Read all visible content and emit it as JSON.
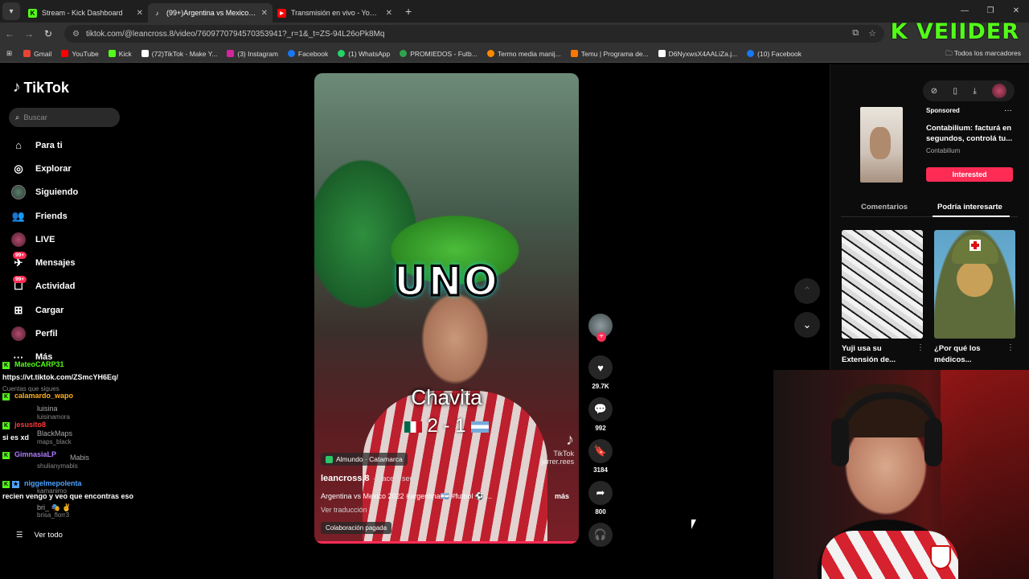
{
  "browser": {
    "tabs": [
      {
        "title": "Stream - Kick Dashboard",
        "favicon": "kick-icon",
        "color": "#53fc18",
        "active": false
      },
      {
        "title": "(99+)Argentina vs Mexico 2022",
        "favicon": "tiktok-icon",
        "color": "#ffffff",
        "active": true
      },
      {
        "title": "Transmisión en vivo - YouTube",
        "favicon": "youtube-icon",
        "color": "#ff0000",
        "active": false
      }
    ],
    "url": "tiktok.com/@leancross.8/video/7609770794570353941?_r=1&_t=ZS-94L26oPk8Mq",
    "bookmarks": [
      {
        "label": "Gmail",
        "color": "#ea4335"
      },
      {
        "label": "YouTube",
        "color": "#ff0000"
      },
      {
        "label": "Kick",
        "color": "#53fc18"
      },
      {
        "label": "(72)TikTok - Make Y...",
        "color": "#ffffff"
      },
      {
        "label": "(3) Instagram",
        "color": "#d6249f"
      },
      {
        "label": "Facebook",
        "color": "#1877f2"
      },
      {
        "label": "(1) WhatsApp",
        "color": "#25d366"
      },
      {
        "label": "PROMIEDOS - Futb...",
        "color": "#2ea44f"
      },
      {
        "label": "Termo media manij...",
        "color": "#ff8a00"
      },
      {
        "label": "Temu | Programa de...",
        "color": "#fb7701"
      },
      {
        "label": "D6NyxwsX4AALiZa.j...",
        "color": "#ffffff"
      },
      {
        "label": "(10) Facebook",
        "color": "#1877f2"
      }
    ],
    "all_bookmarks": "Todos los marcadores",
    "overlay_logo": "K VEIIDER"
  },
  "sidebar": {
    "brand": "TikTok",
    "search_placeholder": "Buscar",
    "items": [
      {
        "label": "Para ti",
        "icon": "home-icon"
      },
      {
        "label": "Explorar",
        "icon": "compass-icon"
      },
      {
        "label": "Siguiendo",
        "icon": "following-avatar-icon"
      },
      {
        "label": "Friends",
        "icon": "friends-icon"
      },
      {
        "label": "LIVE",
        "icon": "live-icon"
      },
      {
        "label": "Mensajes",
        "icon": "messages-icon",
        "badge": "99+"
      },
      {
        "label": "Actividad",
        "icon": "activity-icon",
        "badge": "99+"
      },
      {
        "label": "Cargar",
        "icon": "upload-icon"
      },
      {
        "label": "Perfil",
        "icon": "profile-icon"
      },
      {
        "label": "Más",
        "icon": "more-icon"
      }
    ],
    "see_all": "Ver todo"
  },
  "chat": {
    "lines": [
      {
        "user": "MateoCARP31",
        "color": "#53fc18",
        "text": ""
      },
      {
        "user": "",
        "color": "#ffffff",
        "text": "https://vt.tiktok.com/ZSmcYH6Eq/"
      },
      {
        "user": "",
        "color": "#888888",
        "text": "Cuentas que sigues"
      },
      {
        "user": "calamardo_wapo",
        "color": "#ffb020",
        "text": ""
      },
      {
        "user": "",
        "color": "#aaaaaa",
        "text": "luisina"
      },
      {
        "user": "",
        "color": "#777777",
        "text": "luisinamora"
      },
      {
        "user": "jesusito8",
        "color": "#ff3a3a",
        "text": ""
      },
      {
        "user": "",
        "color": "#ffffff",
        "text": "si es xd"
      },
      {
        "user": "",
        "color": "#aaaaaa",
        "text": "BlackMaps"
      },
      {
        "user": "",
        "color": "#777777",
        "text": "maps_black"
      },
      {
        "user": "GimnasiaLP",
        "color": "#b07cff",
        "text": ""
      },
      {
        "user": "",
        "color": "#aaaaaa",
        "text": "Mabis"
      },
      {
        "user": "",
        "color": "#777777",
        "text": "shulianymabis"
      },
      {
        "user": "niggelmepolenta",
        "color": "#4fa3ff",
        "text": ""
      },
      {
        "user": "",
        "color": "#777777",
        "text": "kamanimo"
      },
      {
        "user": "",
        "color": "#ffffff",
        "text": "recien vengo y veo que encontras eso"
      },
      {
        "user": "",
        "color": "#aaaaaa",
        "text": "bri_ 🎭 ✌"
      },
      {
        "user": "",
        "color": "#777777",
        "text": "brisa_florr3"
      }
    ]
  },
  "video": {
    "overlay_big": "UNO",
    "overlay_name": "Chavita",
    "score": "2 - 1",
    "watermark_brand": "TikTok",
    "watermark_user": "jerrer.rees",
    "location": "Almundo · Catamarca",
    "author": "leancross.8",
    "time_ago": "· Hace 1 sem.",
    "caption": "Argentina vs Mexico 2022 #argentina🇦🇷 #futbol ⚽ ...",
    "more": "más",
    "translate": "Ver traducción",
    "paid": "Colaboración pagada"
  },
  "actions": {
    "likes": "29.7K",
    "comments": "992",
    "saves": "3184",
    "shares": "800"
  },
  "right_panel": {
    "ad": {
      "sponsored": "Sponsored",
      "title": "Contabilium: facturá en segundos, controlá tu...",
      "brand": "Contabilium",
      "cta": "Interested"
    },
    "tabs": [
      "Comentarios",
      "Podría interesarte"
    ],
    "cards": [
      {
        "title": "Yuji usa su Extensión de..."
      },
      {
        "title": "¿Por qué los médicos..."
      }
    ]
  }
}
